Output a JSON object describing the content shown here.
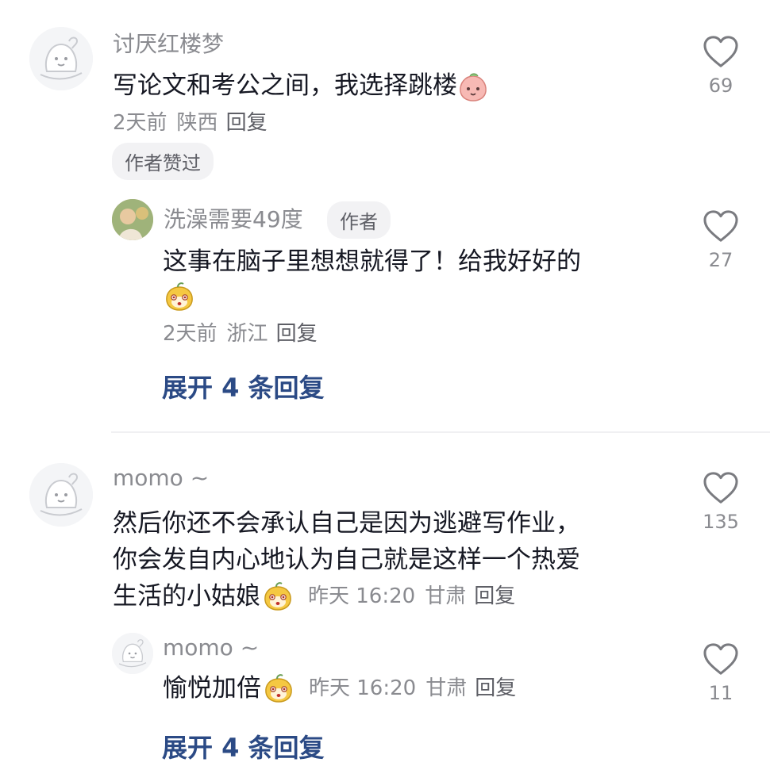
{
  "comments": [
    {
      "author": "讨厌红楼梦",
      "text": "写论文和考公之间，我选择跳楼",
      "emoji": "peach-face-emoji",
      "time": "2天前",
      "location": "陕西",
      "reply_label": "回复",
      "badge": "作者赞过",
      "likes": "69",
      "reply": {
        "author": "洗澡需要49度",
        "author_tag": "作者",
        "text": "这事在脑子里想想就得了！给我好好的",
        "emoji": "yellow-cat-emoji",
        "time": "2天前",
        "location": "浙江",
        "reply_label": "回复",
        "likes": "27"
      },
      "expand_label": "展开 4 条回复"
    },
    {
      "author": "momo ~",
      "text_lines": [
        "然后你还不会承认自己是因为逃避写作业，",
        "你会发自内心地认为自己就是这样一个热爱",
        "生活的小姑娘"
      ],
      "emoji": "yellow-cat-emoji",
      "time": "昨天 16:20",
      "location": "甘肃",
      "reply_label": "回复",
      "likes": "135",
      "reply": {
        "author": "momo ~",
        "text": "愉悦加倍",
        "emoji": "yellow-cat-emoji",
        "time": "昨天 16:20",
        "location": "甘肃",
        "reply_label": "回复",
        "likes": "11"
      },
      "expand_label": "展开 4 条回复"
    }
  ],
  "colors": {
    "accent": "#2b4a85",
    "text": "#161823",
    "muted": "#8a8b90",
    "badge_bg": "#f2f2f4"
  }
}
